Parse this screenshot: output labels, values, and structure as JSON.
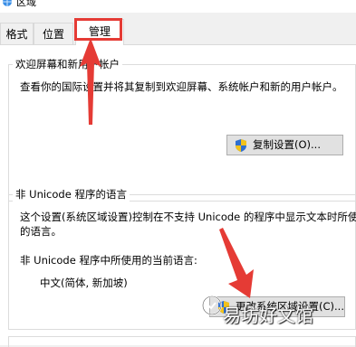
{
  "window": {
    "title": "区域"
  },
  "tabs": [
    {
      "label": "格式"
    },
    {
      "label": "位置"
    },
    {
      "label": "管理",
      "selected": true
    }
  ],
  "welcome": {
    "legend": "欢迎屏幕和新用户帐户",
    "description": "查看你的国际设置并将其复制到欢迎屏幕、系统帐户和新的用户帐户。",
    "button_label": "复制设置(O)..."
  },
  "nonunicode": {
    "legend": "非 Unicode 程序的语言",
    "description_line1": "这个设置(系统区域设置)控制在不支持 Unicode 的程序中显示文本时所使用",
    "description_line2": "的语言。",
    "current_label": "非 Unicode 程序中所使用的当前语言:",
    "current_value": "中文(简体, 新加坡)",
    "button_label": "更改系统区域设置(C)..."
  },
  "watermark": {
    "text": "易坊好文馆"
  },
  "colors": {
    "highlight": "#e53b35",
    "shield_blue": "#2f6fd0",
    "shield_yellow": "#f3c21a"
  }
}
